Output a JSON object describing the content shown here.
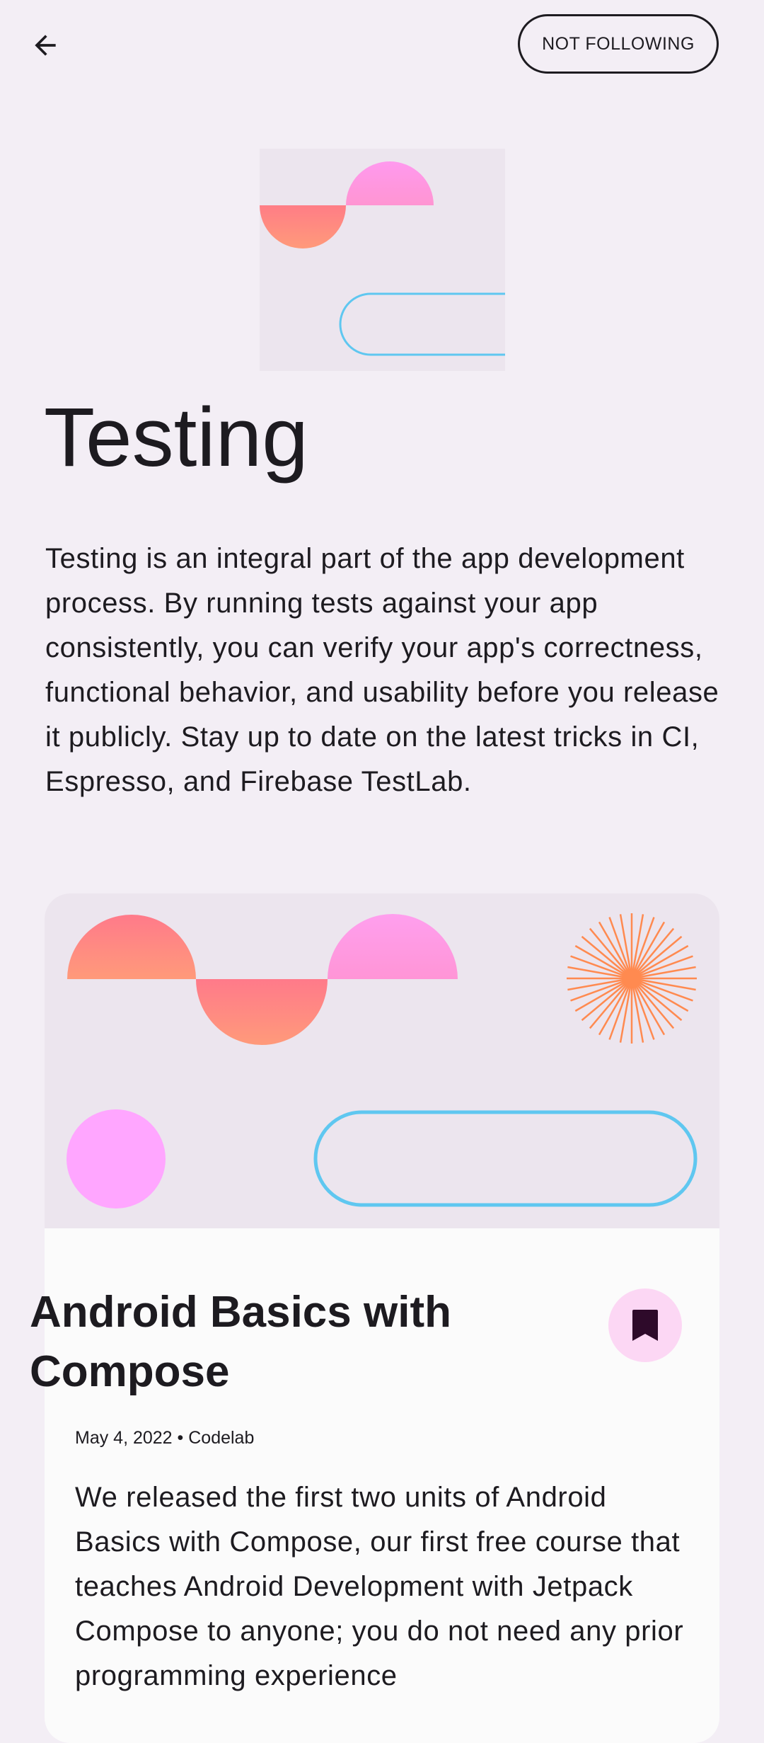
{
  "top_bar": {
    "back_icon": "arrow-back-icon",
    "follow_label": "NOT FOLLOWING"
  },
  "topic": {
    "title": "Testing",
    "description": "Testing is an integral part of the app development process. By running tests against your app consistently, you can verify your app's correctness, functional behavior, and usability before you release it publicly. Stay up to date on the latest tricks in CI, Espresso, and Firebase TestLab."
  },
  "news_card": {
    "title": "Android Basics with Compose",
    "bookmark_icon": "bookmark-icon",
    "meta": "May 4, 2022 • Codelab",
    "body": "We released the first two units of Android Basics with Compose, our first free course that teaches Android Development with Jetpack Compose to anyone; you do not need any prior programming experience"
  },
  "colors": {
    "background": "#f3eef5",
    "image_background": "#ece5ee",
    "card_surface": "#fbfbfb",
    "bookmark_container": "#fcd7f4",
    "bookmark_icon": "#2e0a2a",
    "shape_coral": "#ff8f80",
    "shape_pink": "#ff99e6",
    "shape_magenta": "#ffa6ff",
    "shape_blue": "#5fc7f0",
    "shape_orange": "#ff8a50"
  }
}
